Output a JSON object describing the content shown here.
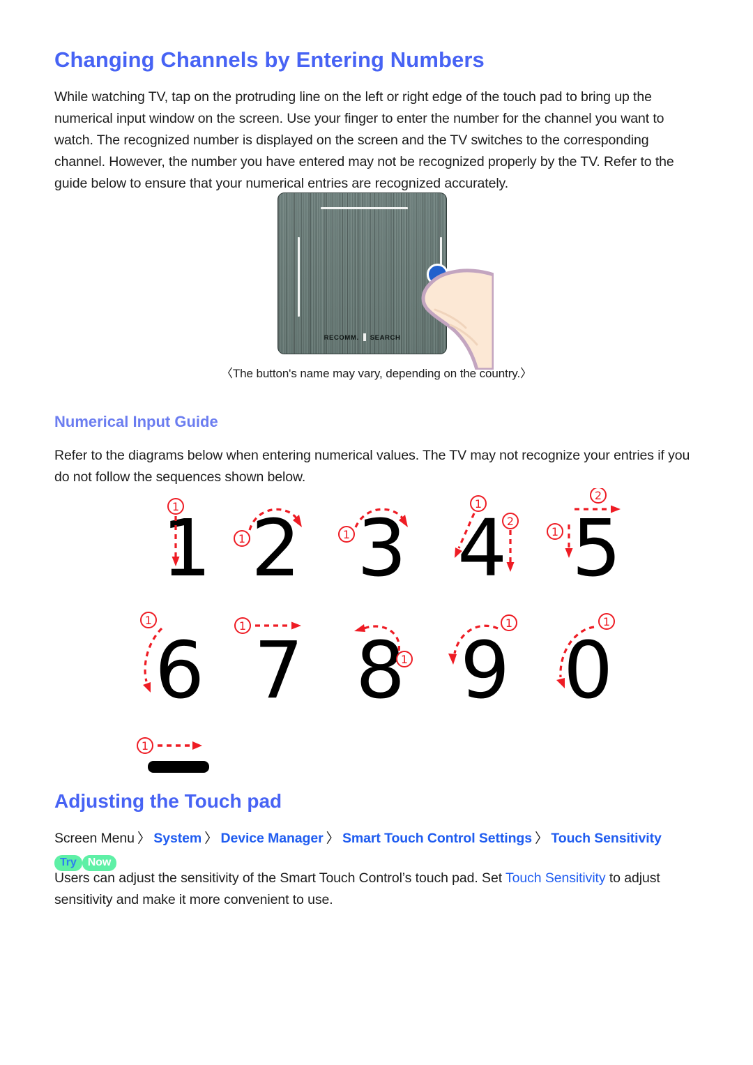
{
  "document": {
    "title": "Changing Channels by Entering Numbers",
    "intro_paragraph": "While watching TV, tap on the protruding line on the left or right edge of the touch pad to bring up the numerical input window on the screen. Use your finger to enter the number for the channel you want to watch. The recognized number is displayed on the screen and the TV switches to the corresponding channel. However, the number you have entered may not be recognized properly by the TV. Refer to the guide below to ensure that your numerical entries are recognized accurately."
  },
  "touchpad_figure": {
    "label_left": "RECOMM.",
    "label_right": "SEARCH",
    "caption": "〈The button's name may vary, depending on the country.〉",
    "surface_color": "#6b7d79",
    "marker_color": "#f2f4f3",
    "touch_dot_color": "#2160cc",
    "finger_skin_color": "#fce8d5",
    "finger_outline_color": "#c3a5c0"
  },
  "numerical_input_guide": {
    "heading": "Numerical Input Guide",
    "paragraph": "Refer to the diagrams below when entering numerical values. The TV may not recognize your entries if you do not follow the sequences shown below.",
    "stroke_arrow_color": "#ee1c24",
    "glyph_color": "#000000",
    "glyphs": [
      {
        "char": "1",
        "strokes": [
          "①"
        ],
        "row": 0,
        "col": 0
      },
      {
        "char": "2",
        "strokes": [
          "①"
        ],
        "row": 0,
        "col": 1
      },
      {
        "char": "3",
        "strokes": [
          "①"
        ],
        "row": 0,
        "col": 2
      },
      {
        "char": "4",
        "strokes": [
          "①",
          "②"
        ],
        "row": 0,
        "col": 3
      },
      {
        "char": "5",
        "strokes": [
          "①",
          "②"
        ],
        "row": 0,
        "col": 4
      },
      {
        "char": "6",
        "strokes": [
          "①"
        ],
        "row": 1,
        "col": 0
      },
      {
        "char": "7",
        "strokes": [
          "①"
        ],
        "row": 1,
        "col": 1
      },
      {
        "char": "8",
        "strokes": [
          "①"
        ],
        "row": 1,
        "col": 2
      },
      {
        "char": "9",
        "strokes": [
          "①"
        ],
        "row": 1,
        "col": 3
      },
      {
        "char": "0",
        "strokes": [
          "①"
        ],
        "row": 1,
        "col": 4
      },
      {
        "char": "-",
        "strokes": [
          "①"
        ],
        "row": 2,
        "col": 0
      }
    ]
  },
  "adjusting_touch_pad": {
    "heading": "Adjusting the Touch pad",
    "breadcrumb": {
      "root": "Screen Menu",
      "separator": "〉",
      "items": [
        "System",
        "Device Manager",
        "Smart Touch Control Settings",
        "Touch Sensitivity"
      ],
      "badge_try": "Try",
      "badge_now": "Now",
      "badge_color": "#5ef0a6"
    },
    "paragraph_prefix": "Users can adjust the sensitivity of the Smart Touch Control’s touch pad. Set ",
    "paragraph_link": "Touch Sensitivity",
    "paragraph_suffix": " to adjust sensitivity and make it more convenient to use."
  },
  "theme": {
    "heading_blue": "#4763f4",
    "subheading_blue": "#6b7df0",
    "link_blue": "#1f5cf0",
    "body_text": "#1c1c1c",
    "background": "#ffffff"
  }
}
